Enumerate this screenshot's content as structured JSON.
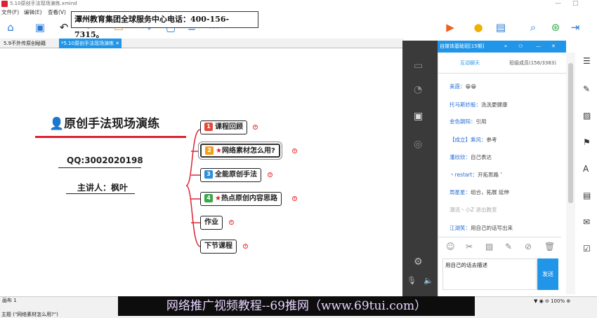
{
  "window": {
    "title": "5.10原创手法现场演练.xmind",
    "minimize": "—",
    "maximize": "□"
  },
  "menu": [
    "文件(F)",
    "编辑(E)",
    "查看(V)"
  ],
  "banner": "潭州教育集团全球服务中心电话：400-156-7315。",
  "tabs": [
    "5.9不外传原创秘籍",
    "*5.10原创手法现场演练 ✕"
  ],
  "mindmap": {
    "central": "原创手法现场演练",
    "qq": "QQ:3002020198",
    "host": "主讲人：枫叶",
    "topics": [
      {
        "num": "1",
        "star": "",
        "label": "课程回顾",
        "color": "#e34a3c"
      },
      {
        "num": "2",
        "star": "★",
        "label": "网络素材怎么用?",
        "color": "#f0a020"
      },
      {
        "num": "3",
        "star": "",
        "label": "全能原创手法",
        "color": "#2f8fd8"
      },
      {
        "num": "4",
        "star": "★",
        "label": "热点原创内容思路",
        "color": "#3aa84a"
      },
      {
        "num": "",
        "star": "",
        "label": "作业",
        "color": ""
      },
      {
        "num": "",
        "star": "",
        "label": "下节课程",
        "color": ""
      }
    ]
  },
  "chat": {
    "header": "自媒体基础班[15期]",
    "tab_chat": "互动聊天",
    "tab_members": "班级成员(156/3383)",
    "messages": [
      {
        "user": "美霞：",
        "text": "😁😁"
      },
      {
        "user": "托马斯妙股：",
        "text": "洗洗更健康"
      },
      {
        "user": "金色朝阳：",
        "text": "引用"
      },
      {
        "user": "【成立】乘风：",
        "text": "参考"
      },
      {
        "user": "潘欣欣：",
        "text": "自己表达"
      },
      {
        "user": "丶restart：",
        "text": "开拓思路 '"
      },
      {
        "user": "周星星：",
        "text": "组合，拓展 延伸"
      },
      {
        "user": "",
        "text": "潮流丶小Z 退出教室"
      },
      {
        "user": "江湖笑：",
        "text": "用自己的话写出来"
      }
    ],
    "input": "用自己的话去描述",
    "send": "发送"
  },
  "sheet": "画布 1",
  "status": "主题 (\"网络素材怎么用?\")",
  "zoom": "100%",
  "watermark": "网络推广视频教程--69推网（www.69tui.com）"
}
